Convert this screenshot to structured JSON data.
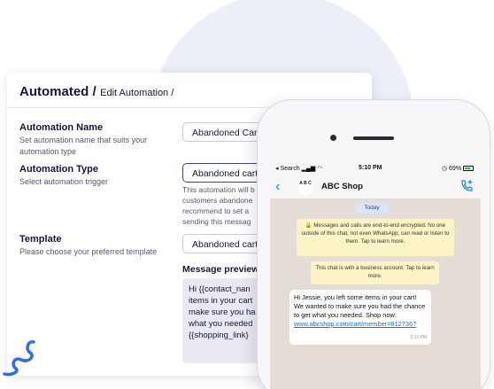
{
  "breadcrumb": {
    "main": "Automated /",
    "sub": "Edit Automation /"
  },
  "automation_name": {
    "title": "Automation Name",
    "description": "Set automation name that suits your automation type",
    "value": "Abandoned Cart -"
  },
  "automation_type": {
    "title": "Automation Type",
    "description": "Select automation trigger",
    "value": "Abandoned cart",
    "hint": [
      "This automation will b",
      "customers abandone",
      "recommend to set a",
      "sending this messag"
    ]
  },
  "template": {
    "title": "Template",
    "description": "Please choose your preferred template",
    "value": "Abandoned cart"
  },
  "preview": {
    "title": "Message preview:",
    "lines": [
      "Hi {{contact_nan",
      "items in your cart",
      "make sure you ha",
      "what you needed",
      "{{shopping_link}"
    ]
  },
  "phone": {
    "status": {
      "back_label": "◂ Search",
      "time": "5:10 PM",
      "battery": "69%"
    },
    "chat": {
      "shop_avatar": "A B C",
      "shop_name": "ABC Shop",
      "day": "Today",
      "encryption_notice": "Messages and calls are end-to-end encrypted. No one outside of this chat, not even WhatsApp, can read or listen to them. Tap to learn more.",
      "business_notice": "This chat is with a business account. Tap to learn more.",
      "message_text": "Hi Jessie, you left some items in your cart! We wanted to make sure you had the chance to get what you needed. Shop now:",
      "message_link": "www.abcshop.com/cart/member=812736?",
      "message_time": "5:10 PM"
    }
  },
  "colors": {
    "accent": "#3d3f8a",
    "squiggle_purple": "#7b3fe4",
    "squiggle_blue": "#2c6ef2",
    "link": "#1d6fd8"
  }
}
